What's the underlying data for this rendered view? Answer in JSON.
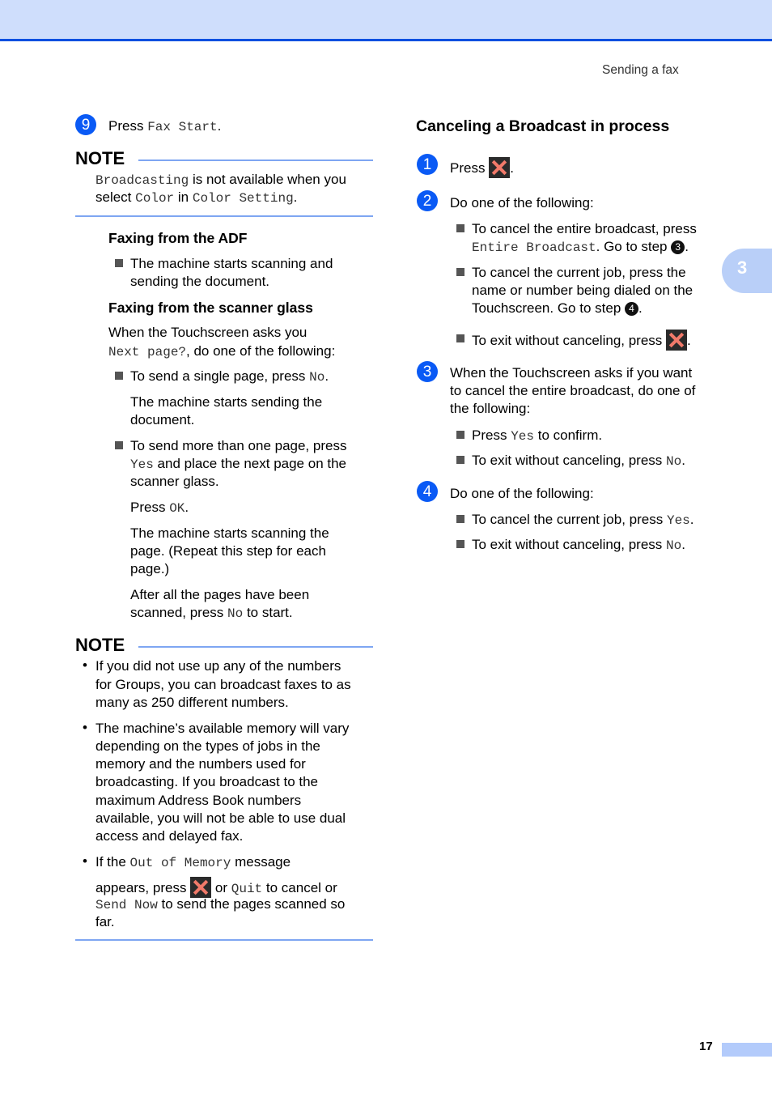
{
  "header": {
    "running_head": "Sending a fax",
    "chapter_tab": "3"
  },
  "footer": {
    "page_number": "17"
  },
  "left": {
    "step9": {
      "badge": "9",
      "pre": "Press ",
      "code": "Fax Start",
      "post": "."
    },
    "note1": {
      "title": "NOTE",
      "code1": "Broadcasting",
      "t1": " is not available when you",
      "t2": "select ",
      "code2": "Color",
      "t3": " in ",
      "code3": "Color Setting",
      "t4": "."
    },
    "adf": {
      "heading": "Faxing from the ADF",
      "bullet_l1": "The machine starts scanning and",
      "bullet_l2": "sending the document."
    },
    "glass": {
      "heading": "Faxing from the scanner glass",
      "intro_l1": "When the Touchscreen asks you",
      "intro_code": "Next page?",
      "intro_l2": ", do one of the following:",
      "b1_pre": "To send a single page, press ",
      "b1_code": "No",
      "b1_post": ".",
      "b1_p_l1": "The machine starts sending the",
      "b1_p_l2": "document.",
      "b2_l1": "To send more than one page, press",
      "b2_code": "Yes",
      "b2_l2": " and place the next page on the",
      "b2_l3": "scanner glass.",
      "press_pre": "Press ",
      "press_code": "OK",
      "press_post": ".",
      "scan_l1": "The machine starts scanning the",
      "scan_l2": "page. (Repeat this step for each",
      "scan_l3": "page.)",
      "after_l1": "After all the pages have been",
      "after_l2_pre": "scanned, press ",
      "after_code": "No",
      "after_l2_post": " to start."
    },
    "note2": {
      "title": "NOTE",
      "items": [
        {
          "lines": [
            "If you did not use up any of the numbers",
            "for Groups, you can broadcast faxes to as",
            "many as 250 different numbers."
          ]
        },
        {
          "lines": [
            "The machine’s available memory will vary",
            "depending on the types of jobs in the",
            "memory and the numbers used for",
            "broadcasting. If you broadcast to the",
            "maximum Address Book numbers",
            "available, you will not be able to use dual",
            "access and delayed fax."
          ]
        }
      ],
      "item3": {
        "pre": "If the ",
        "code1": "Out of Memory",
        "post1": " message",
        "l2_pre": "appears, press ",
        "l2_mid": " or ",
        "code2": "Quit",
        "l2_post": " to cancel or",
        "code3": "Send Now",
        "l3_post": " to send the pages scanned so",
        "l4": "far."
      }
    }
  },
  "right": {
    "heading": "Canceling a Broadcast in process",
    "step1": {
      "badge": "1",
      "pre": "Press ",
      "post": "."
    },
    "step2": {
      "badge": "2",
      "text": "Do one of the following:",
      "b1_l1": "To cancel the entire broadcast, press",
      "b1_code": "Entire Broadcast",
      "b1_l2": ". Go to step ",
      "b1_ref": "3",
      "b1_end": ".",
      "b2_l1": "To cancel the current job, press the",
      "b2_l2": "name or number being dialed on the",
      "b2_l3": "Touchscreen. Go to step ",
      "b2_ref": "4",
      "b2_end": ".",
      "b3_pre": "To exit without canceling, press ",
      "b3_post": "."
    },
    "step3": {
      "badge": "3",
      "l1": "When the Touchscreen asks if you want",
      "l2": "to cancel the entire broadcast, do one of",
      "l3": "the following:",
      "b1_pre": "Press ",
      "b1_code": "Yes",
      "b1_post": " to confirm.",
      "b2_pre": "To exit without canceling, press ",
      "b2_code": "No",
      "b2_post": "."
    },
    "step4": {
      "badge": "4",
      "text": "Do one of the following:",
      "b1_pre": "To cancel the current job, press ",
      "b1_code": "Yes",
      "b1_post": ".",
      "b2_pre": "To exit without canceling, press ",
      "b2_code": "No",
      "b2_post": "."
    }
  }
}
